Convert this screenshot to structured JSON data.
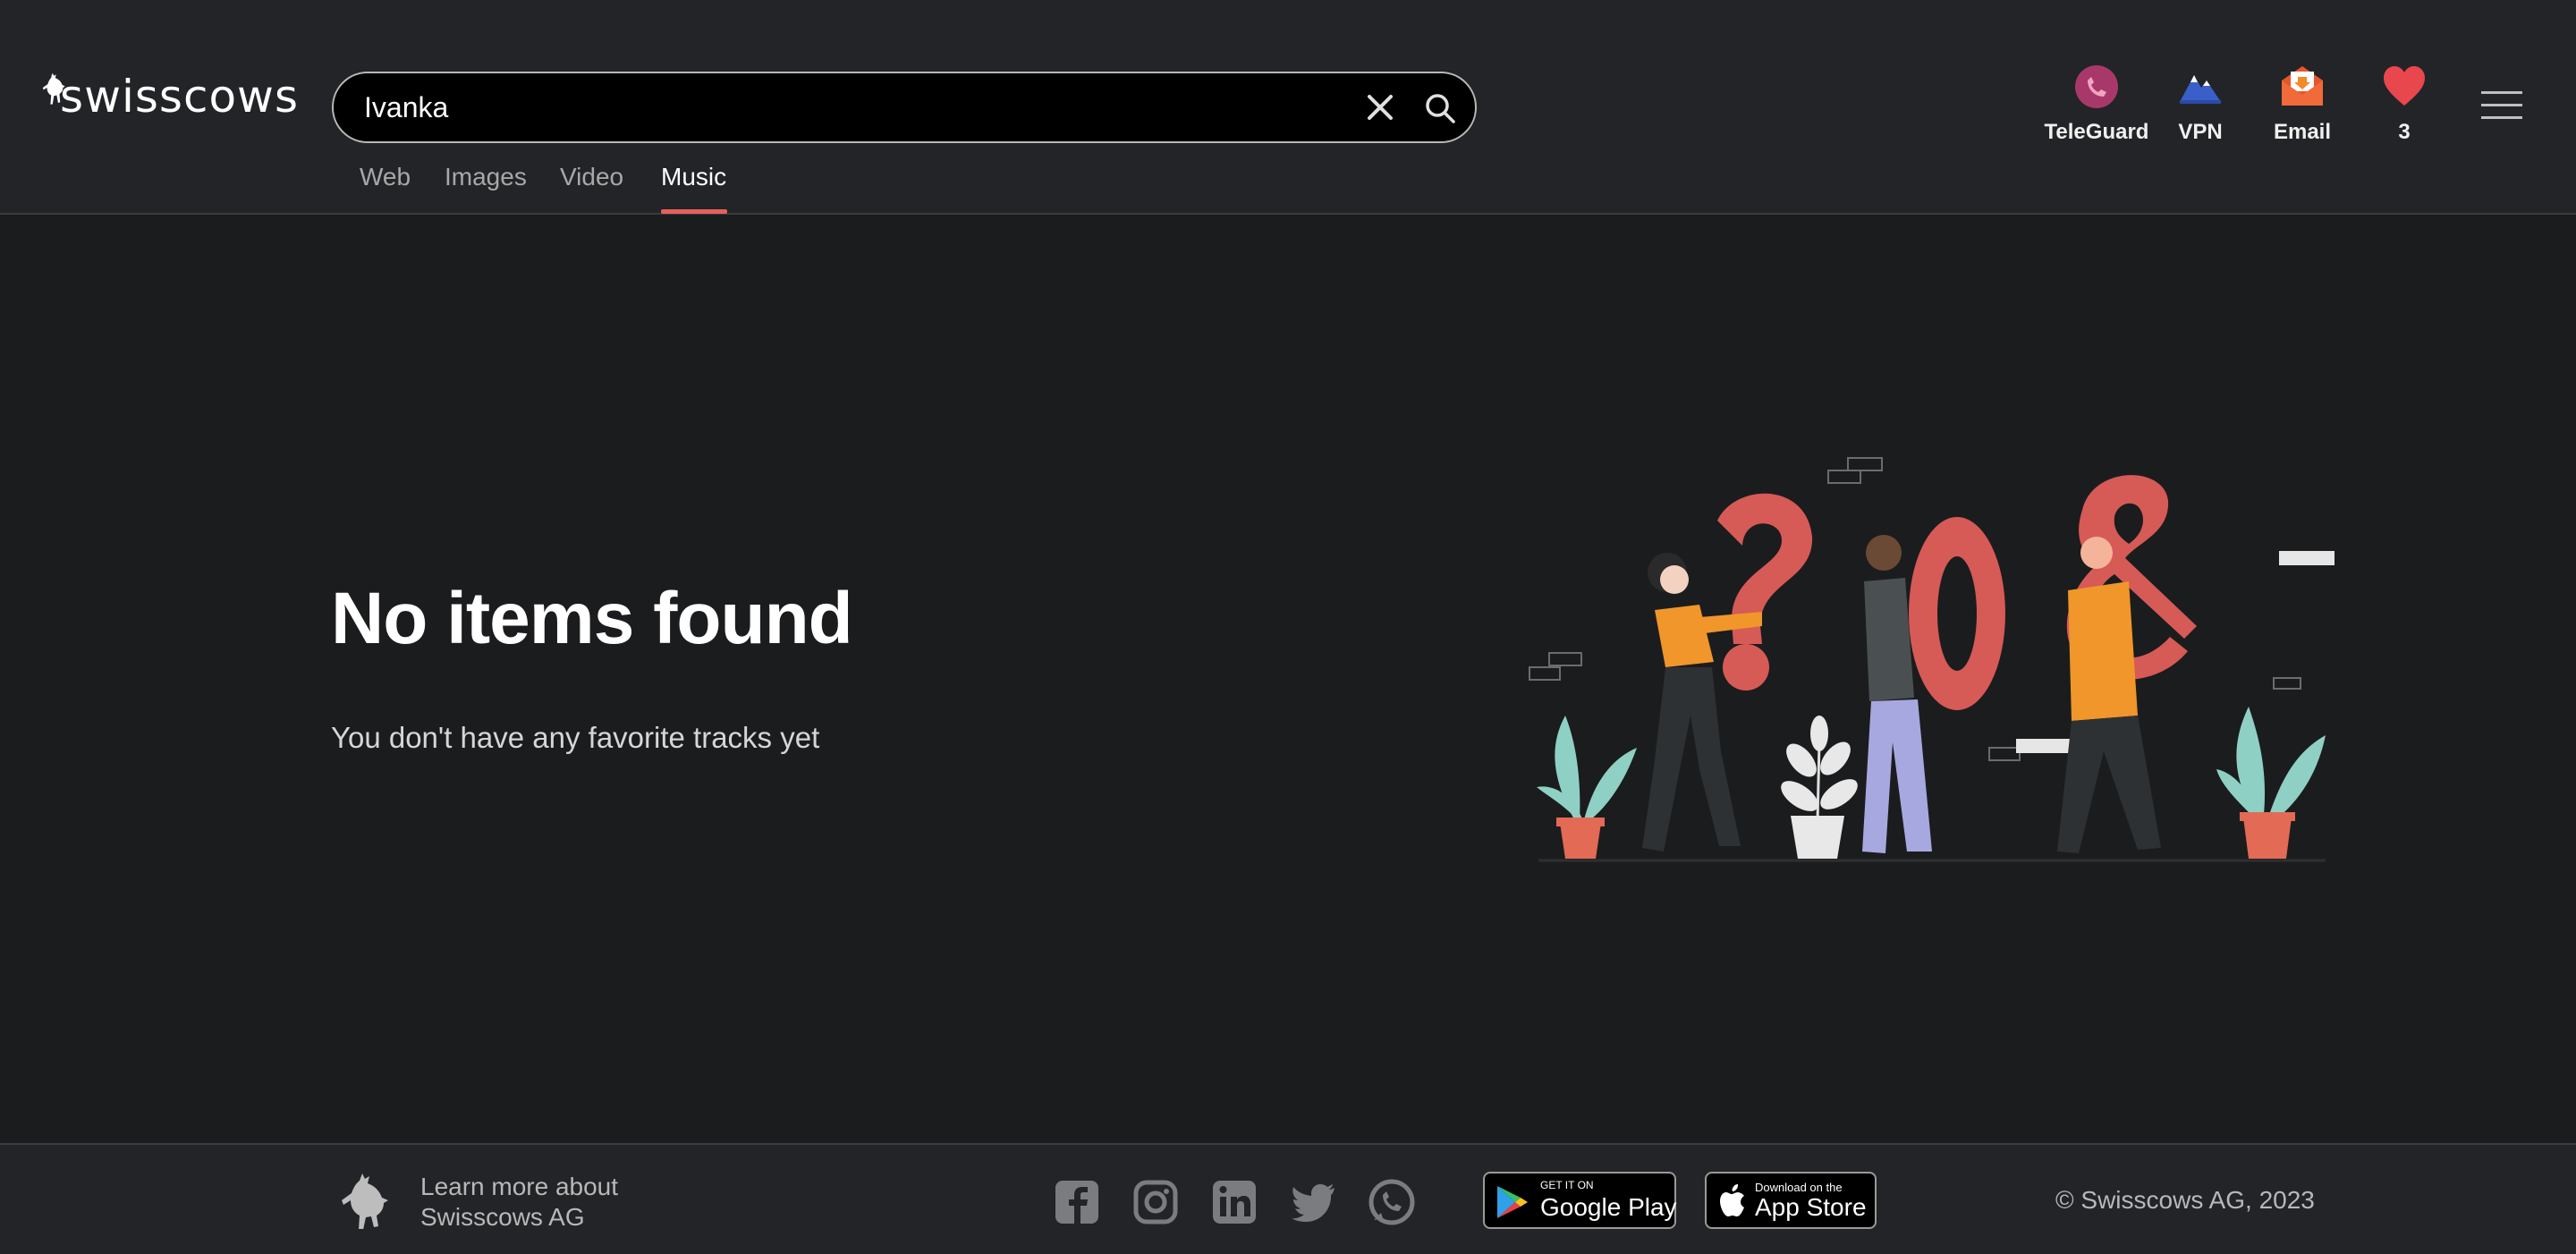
{
  "header": {
    "logo_text": "swisscows",
    "search": {
      "value": "Ivanka",
      "placeholder": ""
    },
    "tabs": [
      {
        "label": "Web",
        "active": false
      },
      {
        "label": "Images",
        "active": false
      },
      {
        "label": "Video",
        "active": false
      },
      {
        "label": "Music",
        "active": true
      }
    ],
    "apps": [
      {
        "label": "TeleGuard",
        "icon": "teleguard-icon"
      },
      {
        "label": "VPN",
        "icon": "vpn-icon"
      },
      {
        "label": "Email",
        "icon": "email-icon"
      },
      {
        "label": "3",
        "icon": "heart-icon"
      }
    ]
  },
  "main": {
    "title": "No items found",
    "subtitle": "You don't have any favorite tracks yet"
  },
  "footer": {
    "about_line1": "Learn more about",
    "about_line2": "Swisscows AG",
    "social": [
      "facebook-icon",
      "instagram-icon",
      "linkedin-icon",
      "twitter-icon",
      "teleguard-icon"
    ],
    "google_play": {
      "small": "GET IT ON",
      "big": "Google Play"
    },
    "app_store": {
      "small": "Download on the",
      "big": "App Store"
    },
    "copyright": "© Swisscows AG, 2023"
  },
  "colors": {
    "background": "#1b1c1e",
    "header": "#222427",
    "accent": "#e8605a",
    "heart": "#e8474d"
  }
}
